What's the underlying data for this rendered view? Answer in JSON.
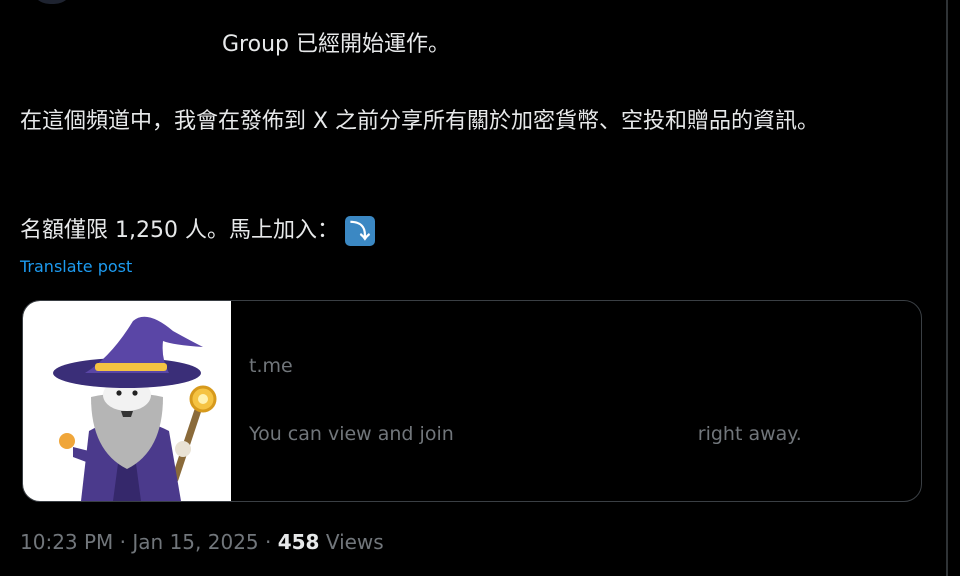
{
  "post": {
    "line1": "Group 已經開始運作。",
    "line2": "在這個頻道中，我會在發佈到 X 之前分享所有關於加密貨幣、空投和贈品的資訊。",
    "line3": "名額僅限 1,250 人。馬上加入：",
    "arrow_emoji": "⤵",
    "translate_label": "Translate post"
  },
  "link_card": {
    "thumbnail_icon": "wizard-illustration",
    "domain": "t.me",
    "description_start": "You can view and join",
    "description_end": "right away."
  },
  "meta": {
    "time": "10:23 PM",
    "separator": "·",
    "date": "Jan 15, 2025",
    "views_count": "458",
    "views_label": "Views"
  },
  "colors": {
    "background": "#000000",
    "text": "#e7e9ea",
    "muted": "#71767b",
    "link": "#1d9bf0",
    "card_border": "#3a3f44",
    "emoji_bg": "#3b88c3"
  }
}
